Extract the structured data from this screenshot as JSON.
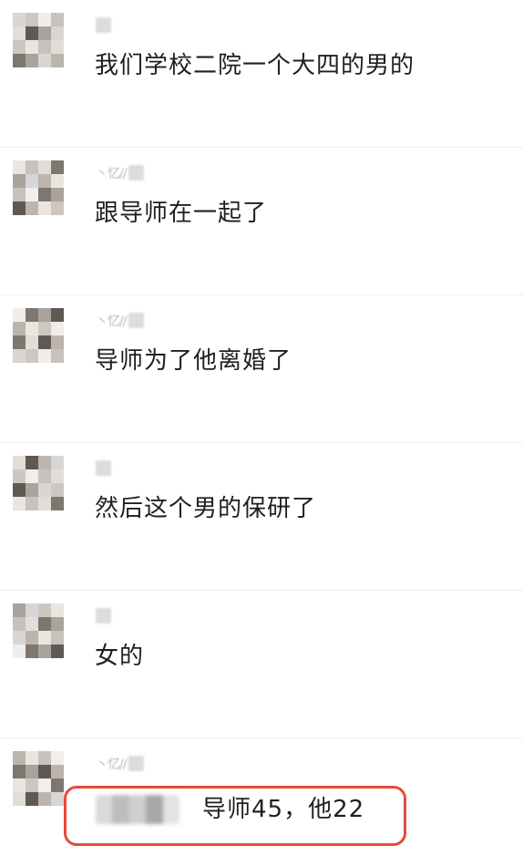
{
  "messages": [
    {
      "text": "我们学校二院一个大四的男的"
    },
    {
      "text": "跟导师在一起了"
    },
    {
      "text": "导师为了他离婚了"
    },
    {
      "text": "然后这个男的保研了"
    },
    {
      "text": "女的"
    },
    {
      "text": "导师45，他22"
    }
  ],
  "colors": {
    "background": "#ffffff",
    "text": "#1f1f1f",
    "highlight_border": "#e84a3b",
    "divider": "#eeeeee"
  },
  "icons": {
    "avatar": "pixelated-avatar",
    "name": "blurred-sender-name"
  }
}
